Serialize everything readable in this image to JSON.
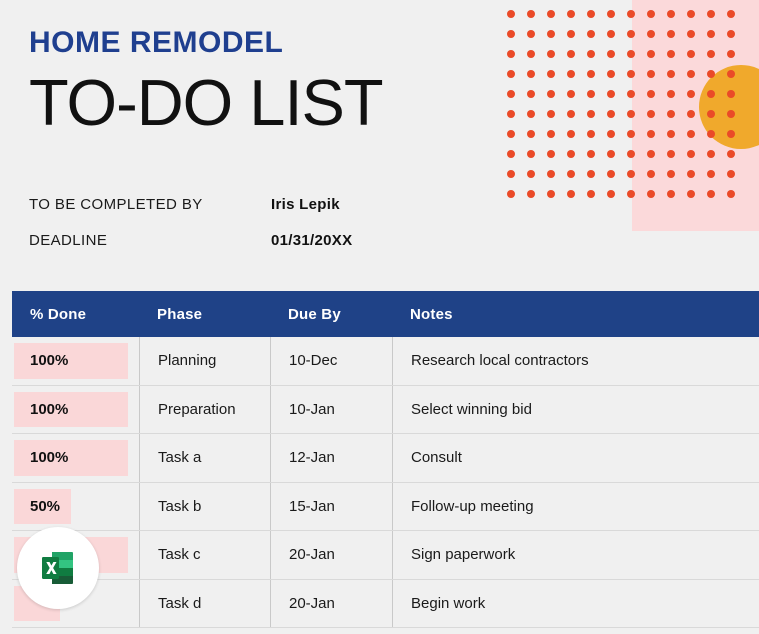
{
  "document": {
    "eyebrow_title": "HOME REMODEL",
    "main_title": "TO-DO LIST"
  },
  "meta": {
    "rows": [
      {
        "label": "TO BE COMPLETED BY",
        "value": "Iris Lepik"
      },
      {
        "label": "DEADLINE",
        "value": "01/31/20XX"
      }
    ]
  },
  "table": {
    "headers": [
      "% Done",
      "Phase",
      "Due By",
      "Notes"
    ],
    "rows": [
      {
        "percent": "100%",
        "percent_value": 100,
        "phase": "Planning",
        "due_by": "10-Dec",
        "notes": "Research local contractors"
      },
      {
        "percent": "100%",
        "percent_value": 100,
        "phase": "Preparation",
        "due_by": "10-Jan",
        "notes": "Select winning bid"
      },
      {
        "percent": "100%",
        "percent_value": 100,
        "phase": "Task a",
        "due_by": "12-Jan",
        "notes": "Consult"
      },
      {
        "percent": "50%",
        "percent_value": 50,
        "phase": "Task b",
        "due_by": "15-Jan",
        "notes": "Follow-up meeting"
      },
      {
        "percent": "",
        "percent_value": 100,
        "phase": "Task c",
        "due_by": "20-Jan",
        "notes": "Sign paperwork"
      },
      {
        "percent": "",
        "percent_value": 40,
        "phase": "Task d",
        "due_by": "20-Jan",
        "notes": "Begin work"
      }
    ]
  },
  "badge": {
    "app_icon": "excel-icon",
    "letter": "X"
  },
  "decor": {
    "dot_icon": "dot-grid",
    "dot_columns": 12,
    "dot_rows": 10,
    "dot_spacing": 20
  },
  "colors": {
    "accent_blue": "#1f3f8f",
    "header_blue": "#1f4287",
    "dot_red": "#ea4a28",
    "pink_panel": "#fbd9da",
    "databar_pink": "#fad7d8",
    "orange_circle": "#f0a92c",
    "page_background": "#f0f0f0",
    "excel_green": "#1d6f42"
  }
}
